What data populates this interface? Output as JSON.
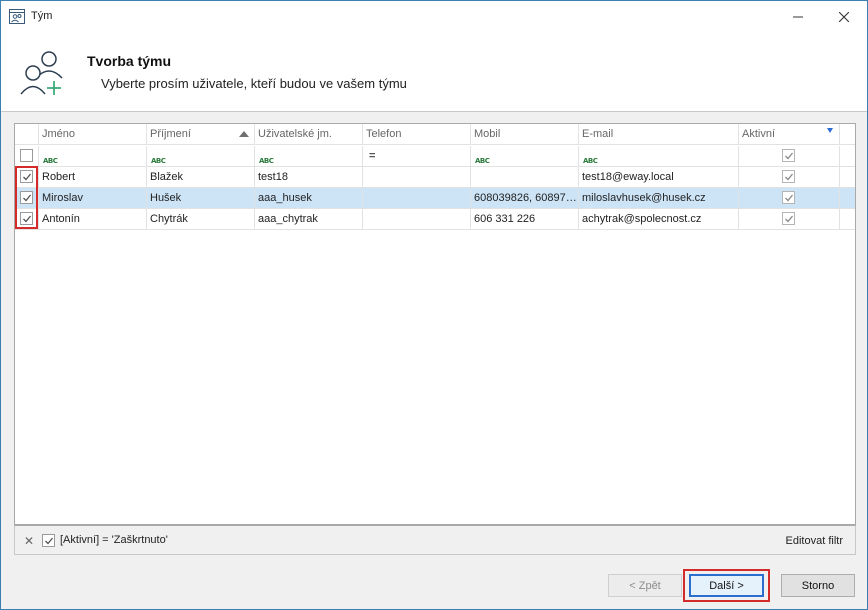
{
  "window": {
    "title": "Tým",
    "minimize_icon": "minimize-icon",
    "close_icon": "close-icon"
  },
  "header": {
    "title": "Tvorba týmu",
    "subtitle": "Vyberte prosím uživatele, kteří budou ve vašem týmu",
    "icon": "add-user-icon"
  },
  "grid": {
    "columns": [
      "Jméno",
      "Příjmení",
      "Uživatelské jm.",
      "Telefon",
      "Mobil",
      "E-mail",
      "Aktivní"
    ],
    "sorted_column": "Příjmení",
    "filter_row": {
      "text_filter_label": "ABC",
      "phone_filter": "="
    },
    "rows": [
      {
        "checked": true,
        "jmeno": "Robert",
        "prijmeni": "Blažek",
        "uzivatel": "test18",
        "telefon": "",
        "mobil": "",
        "email": "test18@eway.local",
        "aktivni": true,
        "selected": false
      },
      {
        "checked": true,
        "jmeno": "Miroslav",
        "prijmeni": "Hušek",
        "uzivatel": "aaa_husek",
        "telefon": "",
        "mobil": "608039826, 60897…",
        "email": "miloslavhusek@husek.cz",
        "aktivni": true,
        "selected": true
      },
      {
        "checked": true,
        "jmeno": "Antonín",
        "prijmeni": "Chytrák",
        "uzivatel": "aaa_chytrak",
        "telefon": "",
        "mobil": "606 331 226",
        "email": "achytrak@spolecnost.cz",
        "aktivni": true,
        "selected": false
      }
    ]
  },
  "filter_bar": {
    "expression": "[Aktivní] = 'Zaškrtnuto'",
    "edit_label": "Editovat filtr"
  },
  "buttons": {
    "back": "< Zpět",
    "next": "Další >",
    "cancel": "Storno"
  },
  "colors": {
    "selected_row": "#cde4f7",
    "highlight": "#d32a2a",
    "accent": "#2a6fce"
  }
}
